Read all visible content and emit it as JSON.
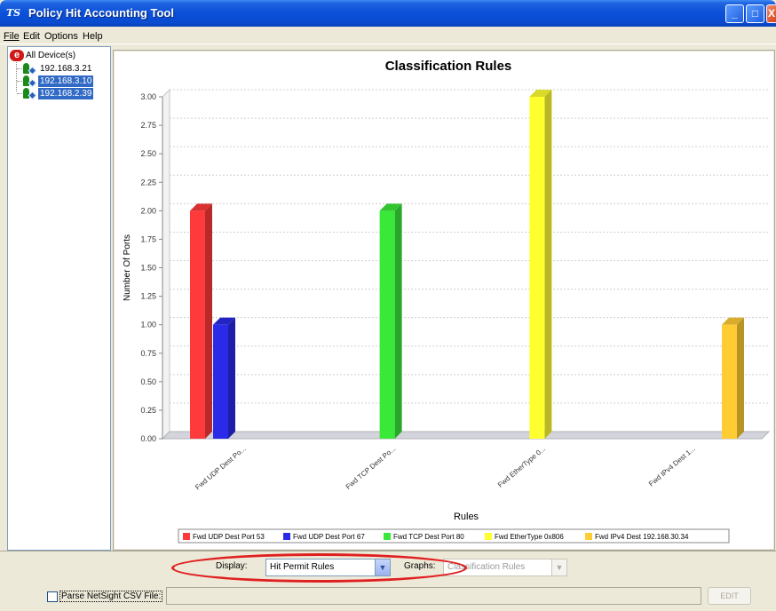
{
  "window": {
    "logo": "TS",
    "title": "Policy Hit Accounting Tool",
    "min_glyph": "_",
    "max_glyph": "□",
    "close_glyph": "X"
  },
  "menu": {
    "file": "File",
    "edit": "Edit",
    "options": "Options",
    "help": "Help"
  },
  "tree": {
    "root_icon": "e",
    "root_label": "All Device(s)",
    "nodes": [
      {
        "label": "192.168.3.21",
        "selected": false
      },
      {
        "label": "192.168.3.10",
        "selected": true
      },
      {
        "label": "192.168.2.39",
        "selected": true
      }
    ]
  },
  "chart_data": {
    "type": "bar",
    "title": "Classification Rules",
    "xlabel": "Rules",
    "ylabel": "Number Of Ports",
    "ylim": [
      0,
      3.0
    ],
    "yticks": [
      "0.00",
      "0.25",
      "0.50",
      "0.75",
      "1.00",
      "1.25",
      "1.50",
      "1.75",
      "2.00",
      "2.25",
      "2.50",
      "2.75",
      "3.00"
    ],
    "grid": true,
    "categories": [
      "Fwd UDP Dest Po...",
      "Fwd TCP Dest Po...",
      "Fwd EtherType 0...",
      "Fwd IPv4 Dest 1..."
    ],
    "series": [
      {
        "name": "Fwd UDP Dest Port 53",
        "color": "#ff3a3a",
        "category": 0,
        "value": 2
      },
      {
        "name": "Fwd UDP Dest Port 67",
        "color": "#2a2ae8",
        "category": 0,
        "value": 1
      },
      {
        "name": "Fwd TCP Dest Port 80",
        "color": "#3ae83a",
        "category": 1,
        "value": 2
      },
      {
        "name": "Fwd EtherType 0x806",
        "color": "#ffff30",
        "category": 2,
        "value": 3
      },
      {
        "name": "Fwd IPv4 Dest 192.168.30.34",
        "color": "#ffcc33",
        "category": 3,
        "value": 1
      }
    ],
    "legend_position": "bottom"
  },
  "bottom": {
    "display_label": "Display:",
    "display_value": "Hit Permit Rules",
    "graphs_label": "Graphs:",
    "graphs_value": "Classification Rules",
    "csv_label": "Parse NetSight CSV File:",
    "edit_label": "EDIT"
  },
  "colors": {
    "title_bar": "#0a50d8",
    "highlight_ellipse": "#e02020",
    "selection": "#316ac5"
  }
}
